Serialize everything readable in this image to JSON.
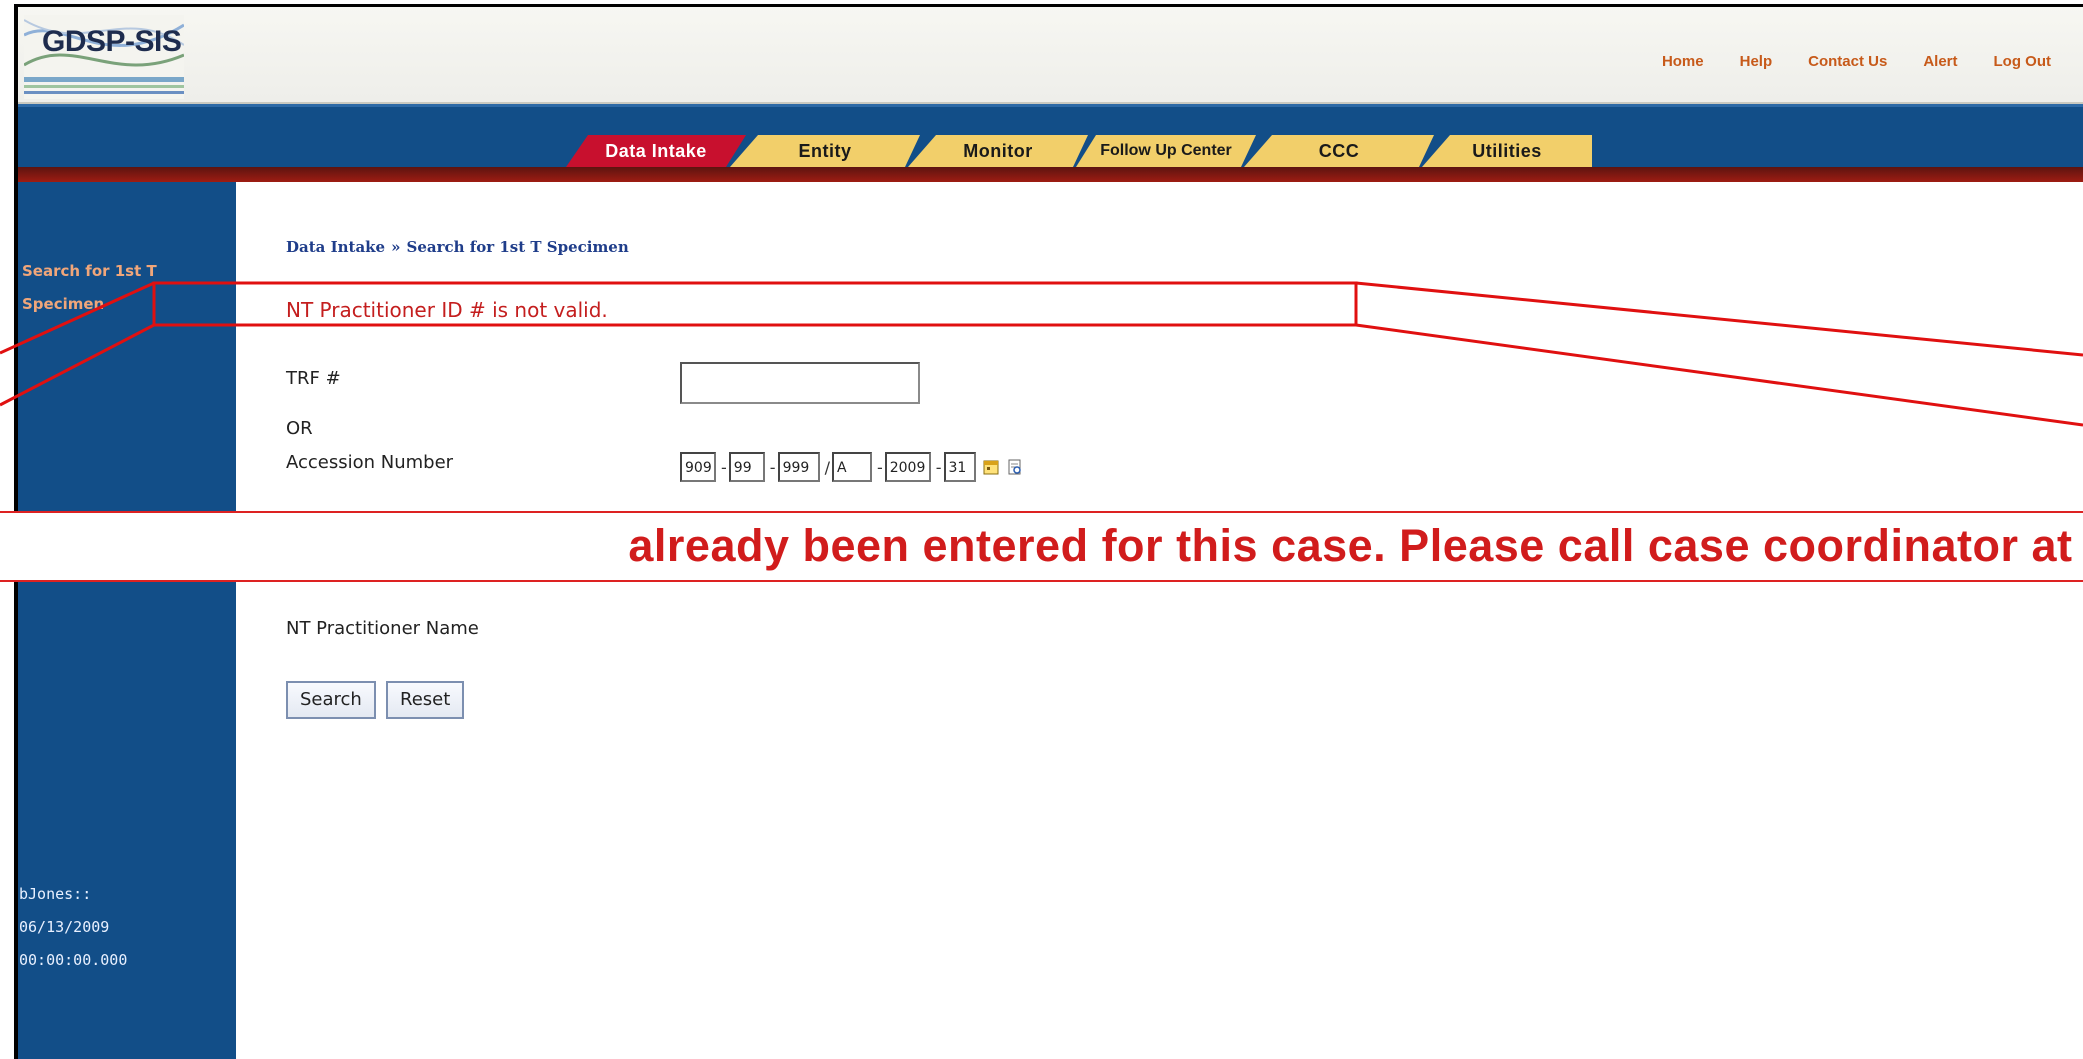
{
  "app": {
    "logo_text": "GDSP-SIS"
  },
  "top_links": [
    "Home",
    "Help",
    "Contact Us",
    "Alert",
    "Log Out"
  ],
  "tabs": [
    {
      "label": "Data Intake",
      "active": true
    },
    {
      "label": "Entity",
      "active": false
    },
    {
      "label": "Monitor",
      "active": false
    },
    {
      "label": "Follow Up Center",
      "active": false
    },
    {
      "label": "CCC",
      "active": false
    },
    {
      "label": "Utilities",
      "active": false
    }
  ],
  "sidebar": {
    "link_line1": "Search for 1st T",
    "link_line2": "Specimen",
    "user_line1": "bJones::",
    "user_line2": "06/13/2009",
    "user_line3": "00:00:00.000"
  },
  "breadcrumb": {
    "root": "Data Intake",
    "separator": "»",
    "current": "Search for 1st T Specimen"
  },
  "error_message": "NT Practitioner ID # is not valid.",
  "form": {
    "trf_label": "TRF #",
    "trf_value": "",
    "or_label": "OR",
    "accession_label": "Accession Number",
    "accession_parts": [
      "909",
      "99",
      "999",
      "A",
      "2009",
      "31"
    ],
    "accession_separators": [
      "-",
      "-",
      "/",
      "-",
      "-"
    ],
    "practitioner_name_label": "NT Practitioner Name",
    "search_button": "Search",
    "reset_button": "Reset"
  },
  "callout": {
    "banner_text": "already been entered for this case. Please call case coordinator at ("
  },
  "colors": {
    "nav_blue": "#124e88",
    "active_tab": "#c8102e",
    "inactive_tab": "#f2cf6a",
    "error_red": "#c41e1e",
    "link_orange": "#c75a1a"
  },
  "icons": {
    "calendar": "calendar-icon",
    "lookup": "lookup-icon"
  }
}
